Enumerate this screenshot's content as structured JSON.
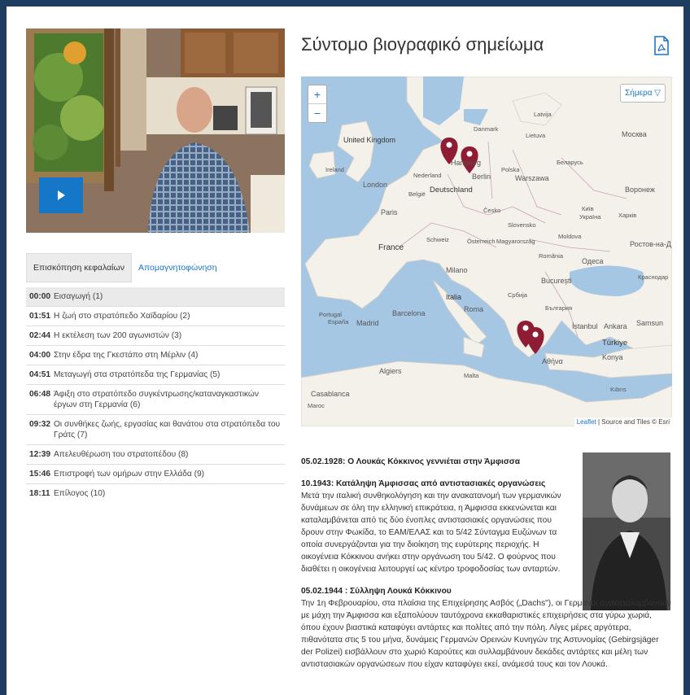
{
  "video": {
    "play_label": "Play"
  },
  "tabs": {
    "overview": "Επισκόπηση κεφαλαίων",
    "transcript": "Απομαγνητοφώνηση"
  },
  "chapters": [
    {
      "time": "00:00",
      "label": "Εισαγωγή (1)"
    },
    {
      "time": "01:51",
      "label": "Η ζωή στο στρατόπεδο Χαϊδαρίου (2)"
    },
    {
      "time": "02:44",
      "label": "Η εκτέλεση των 200 αγωνιστών (3)"
    },
    {
      "time": "04:00",
      "label": "Στην έδρα της Γκεστάπο στη Μέρλιν (4)"
    },
    {
      "time": "04:51",
      "label": "Μεταγωγή στα στρατόπεδα της Γερμανίας (5)"
    },
    {
      "time": "06:48",
      "label": "Άφιξη στο στρατόπεδο συγκέντρωσης/καταναγκαστικών έργων στη Γερμανία (6)"
    },
    {
      "time": "09:32",
      "label": "Οι συνθήκες ζωής, εργασίας και θανάτου στα στρατόπεδα του Γράτς (7)"
    },
    {
      "time": "12:39",
      "label": "Απελευθέρωση του στρατοπέδου (8)"
    },
    {
      "time": "15:46",
      "label": "Επιστροφή των ομήρων στην Ελλάδα (9)"
    },
    {
      "time": "18:11",
      "label": "Επίλογος (10)"
    }
  ],
  "bio_title": "Σύντομο βιογραφικό σημείωμα",
  "map": {
    "zoom_in": "+",
    "zoom_out": "−",
    "today_label": "Σήμερα ▽",
    "attribution_leaflet": "Leaflet",
    "attribution_rest": " | Source and Tiles © Esri",
    "labels": {
      "uk": "United Kingdom",
      "ireland": "Ireland",
      "france": "France",
      "espana": "España",
      "portugal": "Portugal",
      "madrid": "Madrid",
      "barcelona": "Barcelona",
      "italia": "Italia",
      "roma": "Roma",
      "milano": "Milano",
      "deutschland": "Deutschland",
      "berlin": "Berlin",
      "hamburg": "Hamburg",
      "polska": "Polska",
      "warszawa": "Warszawa",
      "cesko": "Česko",
      "osterreich": "Österreich",
      "magyarorszag": "Magyarország",
      "romania": "România",
      "bucuresti": "București",
      "moskva": "Москва",
      "kyiv": "Київ",
      "ukraina": "Україна",
      "belarus": "Беларусь",
      "lietuva": "Lietuva",
      "latvija": "Latvija",
      "danmark": "Danmark",
      "turkiye": "Türkiye",
      "istanbul": "İstanbul",
      "ankara": "Ankara",
      "athina": "Αθήνα",
      "bulgaria": "България",
      "srbija": "Србија",
      "algiers": "Algiers",
      "malta": "Malta",
      "casablanca": "Casablanca",
      "maroc": "Maroc",
      "odesa": "Одеса",
      "kibris": "Kıbrıs",
      "rostov": "Ростов-на-Д",
      "krasnodar": "Краснодар",
      "samsun": "Samsun",
      "konya": "Konya",
      "voronezh": "Воронеж",
      "kharkiv": "Харків",
      "moldova": "Moldova",
      "slovensko": "Slovensko",
      "schweiz": "Schweiz",
      "belgie": "België",
      "nederland": "Nederland",
      "london": "London",
      "paris": "Paris"
    }
  },
  "bio": [
    {
      "head": "05.02.1928: Ο Λουκάς Κόκκινος γεννιέται στην Άμφισσα",
      "text": ""
    },
    {
      "head": "10.1943: Κατάληψη Άμφισσας από αντιστασιακές οργανώσεις",
      "text": "Μετά την ιταλική συνθηκολόγηση και την ανακατανομή των γερμανικών δυνάμεων σε όλη την ελληνική επικράτεια, η Άμφισσα εκκενώνεται και καταλαμβάνεται από τις δύο ένοπλες αντιστασιακές οργανώσεις που δρουν στην Φωκίδα, το ΕΑΜ/ΕΛΑΣ και το 5/42 Σύνταγμα Ευζώνων τα οποία συνεργάζονται για την διοίκηση της ευρύτερης περιοχής. Η οικογένεια Κόκκινου ανήκει στην οργάνωση του 5/42. Ο φούρνος που διαθέτει η οικογένεια λειτουργεί ως κέντρο τροφοδοσίας των ανταρτών."
    },
    {
      "head": "05.02.1944 : Σύλληψη Λουκά Κόκκινου",
      "text": "Την 1η Φεβρουαρίου, στα πλαίσια της Επιχείρησης Ασβός („Dachs\"), οι Γερμανοί ανακαταλαμβάνουν με μάχη την Άμφισσα και εξαπολύουν ταυτόχρονα εκκαθαριστικές επιχειρήσεις στα γύρω χωριά, όπου έχουν βιαστικά καταφύγει αντάρτες και πολίτες από την πόλη. Λίγες μέρες αργότερα, πιθανότατα στις 5 του μήνα, δυνάμεις Γερμανών Ορεινών Κυνηγών της Αστυνομίας (Gebirgsjäger der Polizei) εισβάλλουν στο χωριό Καρούτες και συλλαμβάνουν δεκάδες αντάρτες και μέλη των αντιστασιακών οργανώσεων που είχαν καταφύγει εκεί, ανάμεσά τους και τον Λουκά."
    }
  ]
}
